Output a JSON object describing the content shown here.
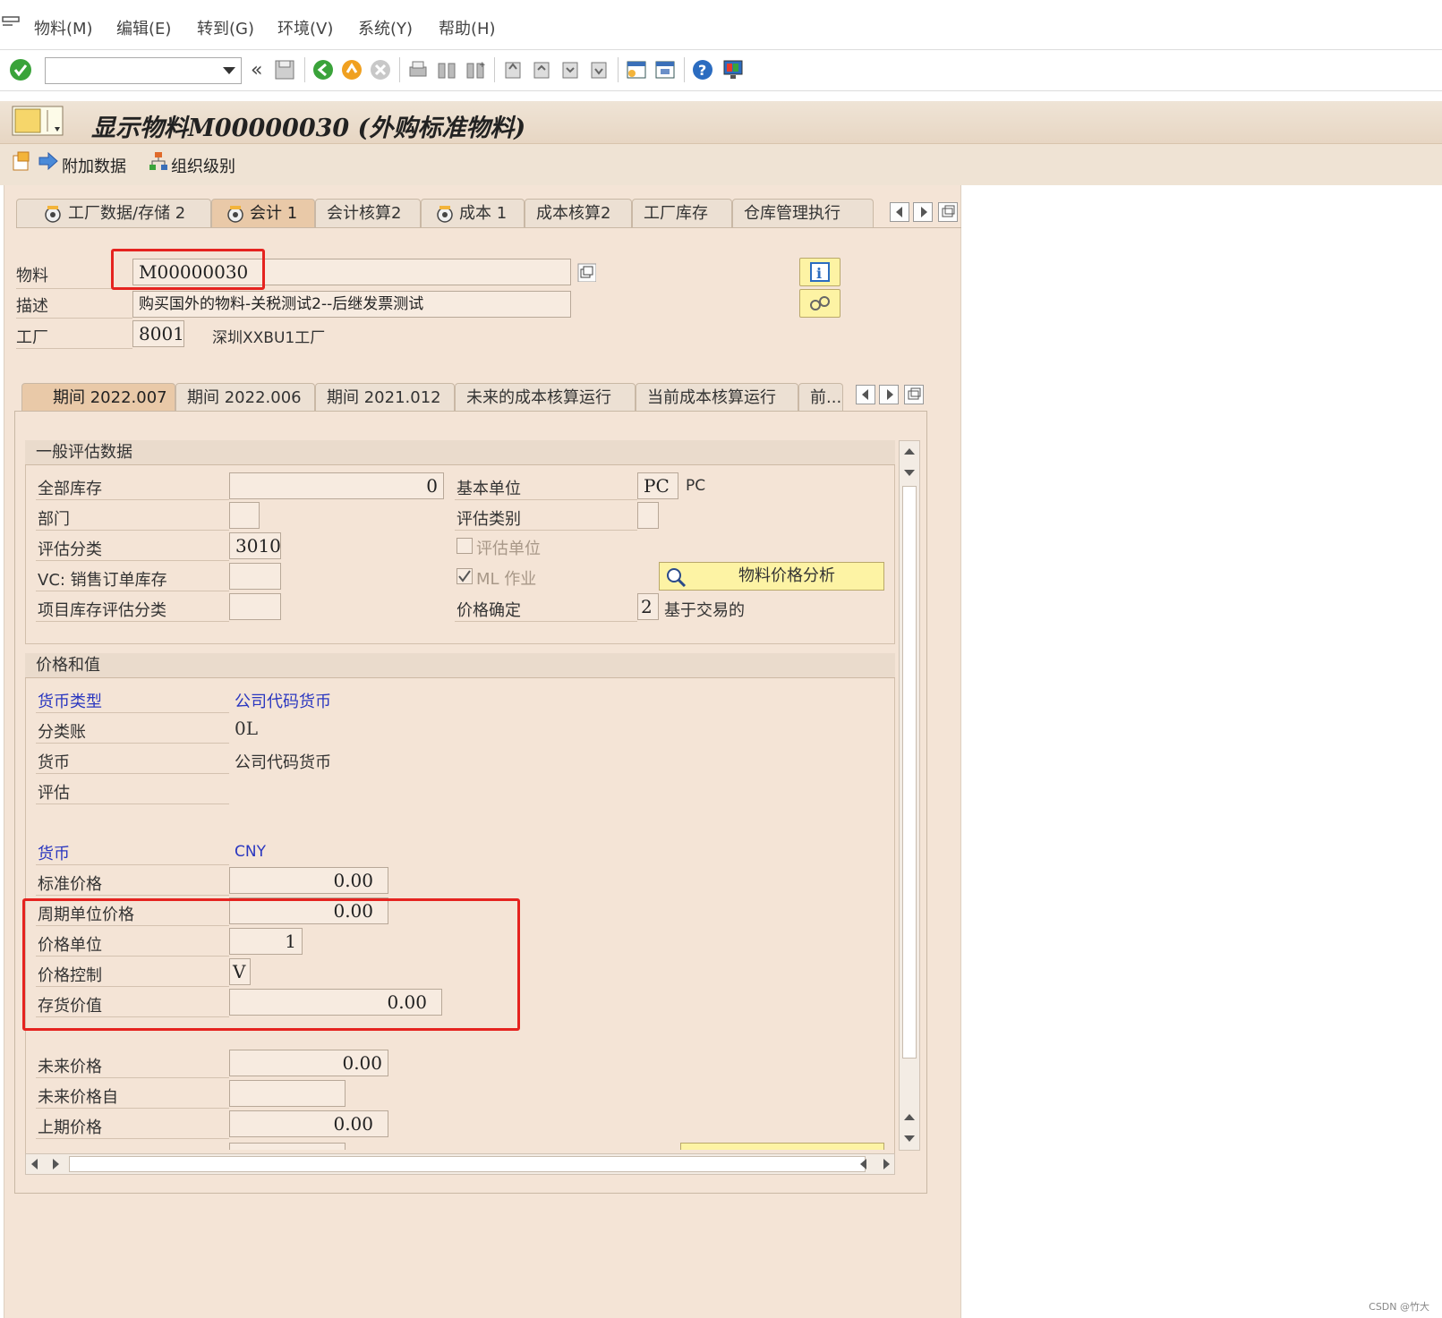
{
  "menu": [
    {
      "label": "物料(M)"
    },
    {
      "label": "编辑(E)"
    },
    {
      "label": "转到(G)"
    },
    {
      "label": "环境(V)"
    },
    {
      "label": "系统(Y)"
    },
    {
      "label": "帮助(H)"
    }
  ],
  "toolbar": {
    "command_value": "",
    "back_glyph": "«"
  },
  "title": "显示物料M00000030 (外购标准物料)",
  "app_toolbar": {
    "additional_data": "附加数据",
    "org_levels": "组织级别"
  },
  "tabs": [
    "工厂数据/存储 2",
    "会计 1",
    "会计核算2",
    "成本 1",
    "成本核算2",
    "工厂库存",
    "仓库管理执行"
  ],
  "header": {
    "material_label": "物料",
    "material_value": "M00000030",
    "description_label": "描述",
    "description_value": "购买国外的物料-关税测试2--后继发票测试",
    "plant_label": "工厂",
    "plant_value": "8001",
    "plant_name": "深圳XXBU1工厂"
  },
  "period_tabs": [
    "期间 2022.007",
    "期间 2022.006",
    "期间 2021.012",
    "未来的成本核算运行",
    "当前成本核算运行",
    "前..."
  ],
  "general": {
    "title": "一般评估数据",
    "total_stock_label": "全部库存",
    "total_stock_value": "0",
    "base_unit_label": "基本单位",
    "base_unit_value": "PC",
    "base_unit_text": "PC",
    "division_label": "部门",
    "division_value": "",
    "valuation_category_label": "评估类别",
    "valuation_category_value": "",
    "valuation_class_label": "评估分类",
    "valuation_class_value": "3010",
    "valuated_unit_label": "评估单位",
    "vc_label": "VC: 销售订单库存",
    "vc_value": "",
    "ml_label": "ML 作业",
    "ml_checked": true,
    "analysis_button": "物料价格分析",
    "project_label": "项目库存评估分类",
    "project_value": "",
    "price_determination_label": "价格确定",
    "price_determination_value": "2",
    "price_determination_text": "基于交易的"
  },
  "prices": {
    "title": "价格和值",
    "currency_type_label": "货币类型",
    "currency_type_value": "公司代码货币",
    "ledger_label": "分类账",
    "ledger_value": "0L",
    "currency_label": "货币",
    "currency_value": "公司代码货币",
    "valuation_label": "评估",
    "valuation_value": "",
    "currency2_label": "货币",
    "currency2_value": "CNY",
    "standard_price_label": "标准价格",
    "standard_price_value": "0.00",
    "periodic_unit_price_label": "周期单位价格",
    "periodic_unit_price_value": "0.00",
    "price_unit_label": "价格单位",
    "price_unit_value": "1",
    "price_control_label": "价格控制",
    "price_control_value": "V",
    "inventory_value_label": "存货价值",
    "inventory_value_value": "0.00",
    "future_price_label": "未来价格",
    "future_price_value": "0.00",
    "future_price_from_label": "未来价格自",
    "future_price_from_value": "",
    "previous_price_label": "上期价格",
    "previous_price_value": "0.00"
  },
  "watermark": "CSDN @竹大",
  "colors": {
    "highlight_red": "#e5231f",
    "link_blue": "#2a37c0",
    "frame_bg": "#f4e4d6"
  }
}
